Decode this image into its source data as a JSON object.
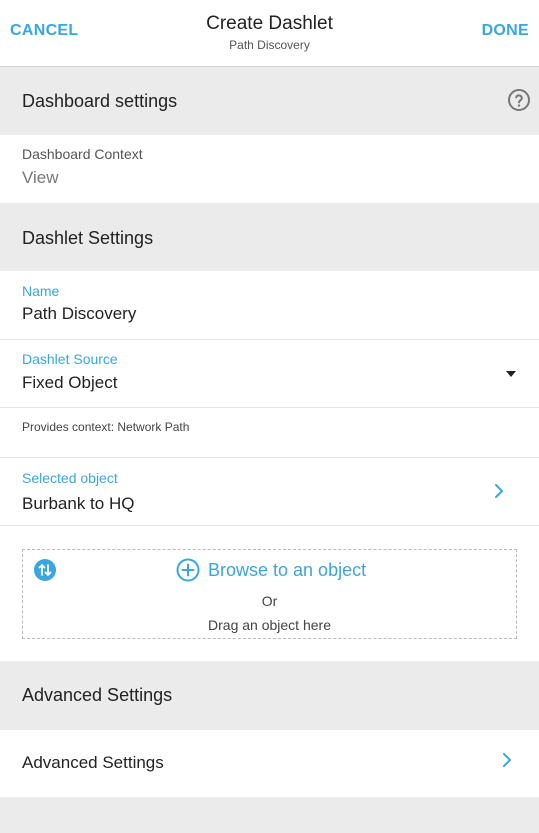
{
  "header": {
    "cancel_label": "CANCEL",
    "done_label": "DONE",
    "title": "Create Dashlet",
    "subtitle": "Path Discovery"
  },
  "dashboard_settings": {
    "title": "Dashboard settings",
    "help_icon": "help-circle-icon",
    "context_label": "Dashboard Context",
    "context_value": "View"
  },
  "dashlet_settings": {
    "title": "Dashlet Settings",
    "name_label": "Name",
    "name_value": "Path Discovery",
    "source_label": "Dashlet Source",
    "source_value": "Fixed Object",
    "provides_context": "Provides context: Network Path",
    "selected_label": "Selected object",
    "selected_value": "Burbank to HQ"
  },
  "dropzone": {
    "swap_icon": "swap-vertical-icon",
    "add_icon": "plus-circle-icon",
    "browse_label": "Browse to an object",
    "or_label": "Or",
    "drag_label": "Drag an object here"
  },
  "advanced": {
    "section_title": "Advanced Settings",
    "row_label": "Advanced Settings"
  },
  "colors": {
    "accent": "#3aa6e0",
    "section_bg": "#ebebeb",
    "text": "#222222"
  }
}
